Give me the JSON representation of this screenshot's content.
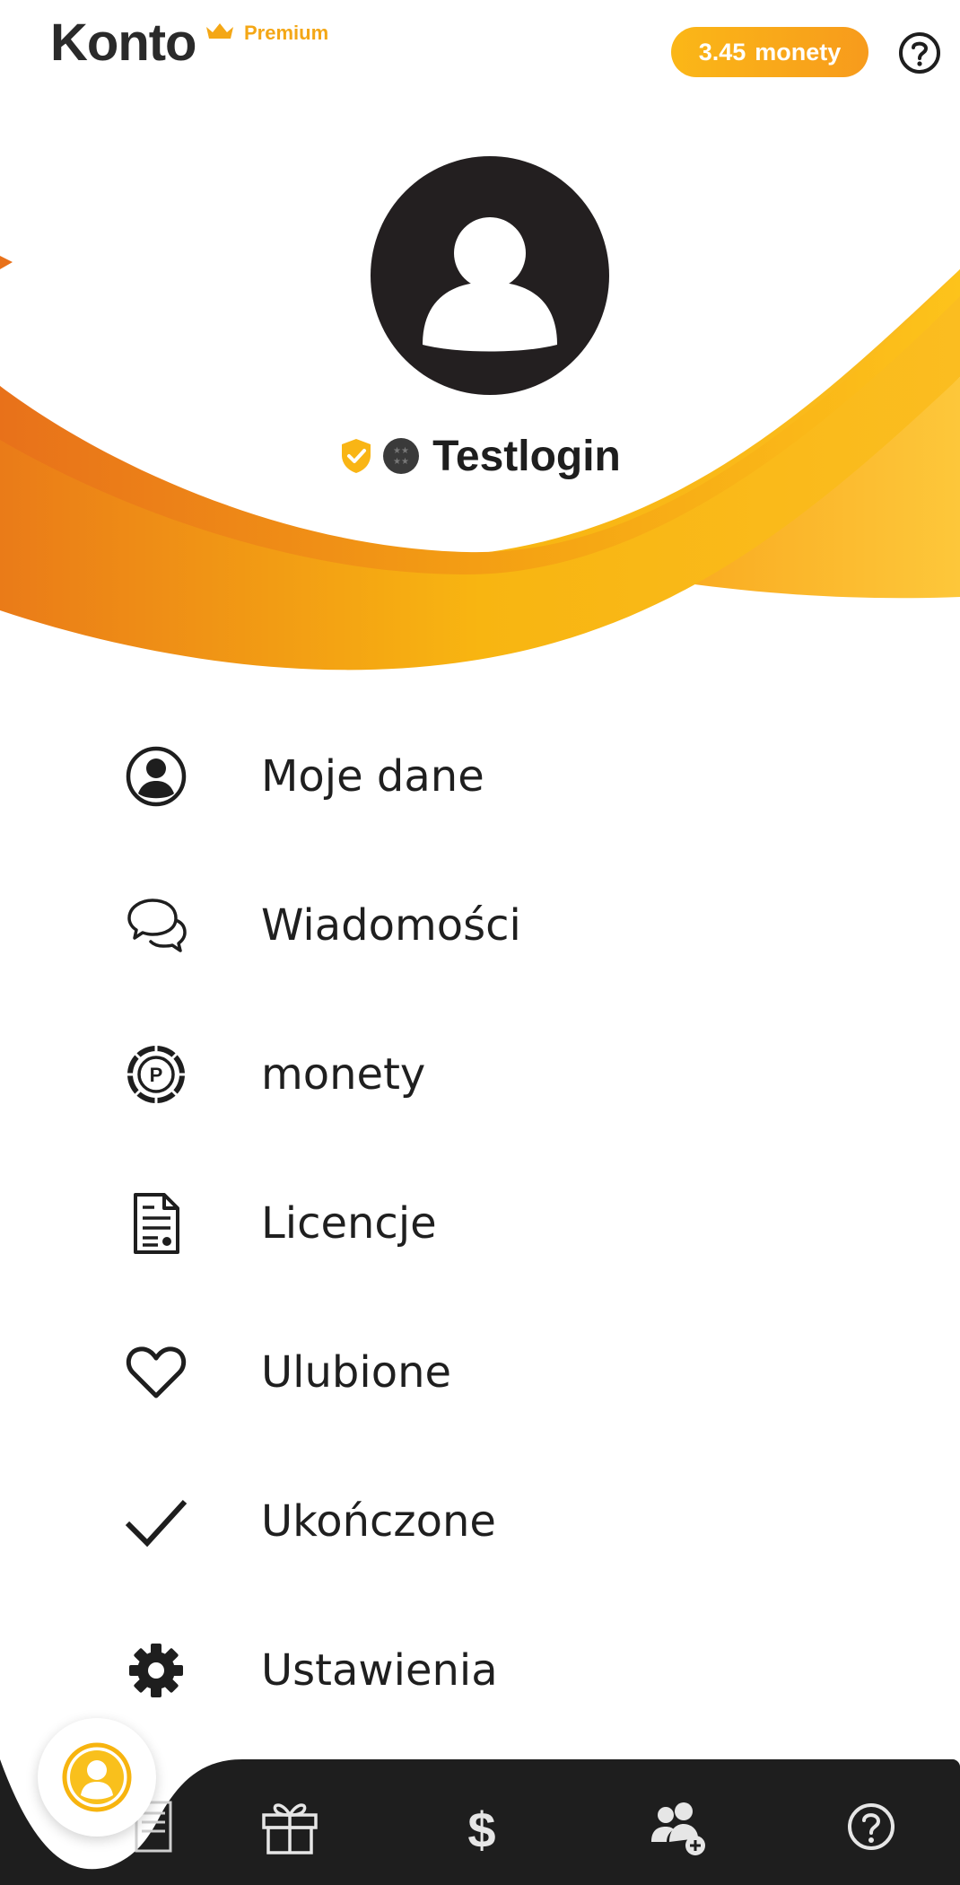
{
  "header": {
    "title": "Konto",
    "premium_label": "Premium",
    "coins_value": "3.45",
    "coins_unit": "monety"
  },
  "profile": {
    "username": "Testlogin"
  },
  "menu": {
    "items": [
      {
        "label": "Moje dane",
        "icon": "user-circle-icon"
      },
      {
        "label": "Wiadomości",
        "icon": "chat-bubbles-icon"
      },
      {
        "label": "monety",
        "icon": "coin-icon"
      },
      {
        "label": "Licencje",
        "icon": "document-icon"
      },
      {
        "label": "Ulubione",
        "icon": "heart-icon"
      },
      {
        "label": "Ukończone",
        "icon": "checkmark-icon"
      },
      {
        "label": "Ustawienia",
        "icon": "gear-icon"
      }
    ]
  },
  "bottom_nav": {
    "items": [
      "profile-icon",
      "document-icon",
      "gift-icon",
      "dollar-icon",
      "add-friend-icon",
      "help-icon"
    ]
  },
  "colors": {
    "accent": "#f7a21b",
    "accent_dark": "#e8711a",
    "accent_light": "#fdc21a",
    "nav_bg": "#1e1e1e",
    "text": "#1f1f1f"
  }
}
